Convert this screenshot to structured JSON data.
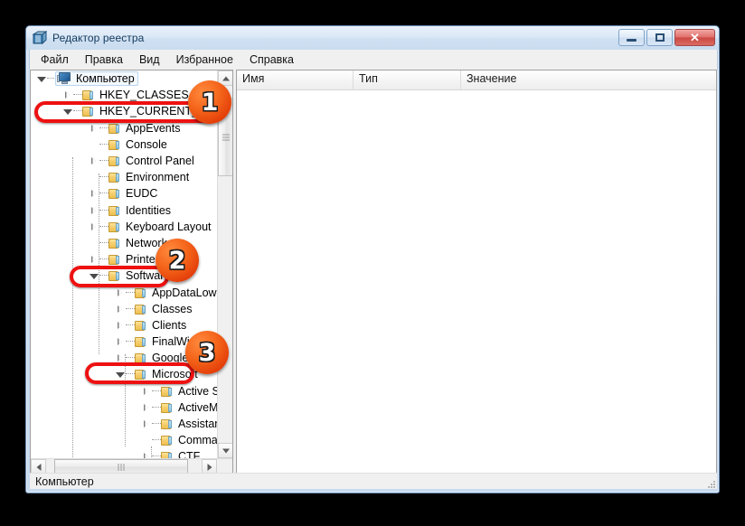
{
  "window": {
    "title": "Редактор реестра",
    "icon": "registry-editor-icon",
    "buttons": {
      "minimize": "minimize-button",
      "maximize": "maximize-button",
      "close": "✕"
    }
  },
  "menu": {
    "items": [
      {
        "label": "Файл"
      },
      {
        "label": "Правка"
      },
      {
        "label": "Вид"
      },
      {
        "label": "Избранное"
      },
      {
        "label": "Справка"
      }
    ]
  },
  "tree": {
    "root": {
      "label": "Компьютер",
      "icon": "computer-icon",
      "expanded": true,
      "selected": true
    },
    "items": [
      {
        "label": "HKEY_CLASSES_ROOT",
        "depth": 1,
        "state": "collapsed"
      },
      {
        "label": "HKEY_CURRENT_USER",
        "depth": 1,
        "state": "expanded"
      },
      {
        "label": "AppEvents",
        "depth": 2,
        "state": "collapsed"
      },
      {
        "label": "Console",
        "depth": 2,
        "state": "leaf"
      },
      {
        "label": "Control Panel",
        "depth": 2,
        "state": "collapsed"
      },
      {
        "label": "Environment",
        "depth": 2,
        "state": "leaf"
      },
      {
        "label": "EUDC",
        "depth": 2,
        "state": "collapsed"
      },
      {
        "label": "Identities",
        "depth": 2,
        "state": "collapsed"
      },
      {
        "label": "Keyboard Layout",
        "depth": 2,
        "state": "collapsed"
      },
      {
        "label": "Network",
        "depth": 2,
        "state": "leaf"
      },
      {
        "label": "Printers",
        "depth": 2,
        "state": "collapsed"
      },
      {
        "label": "Software",
        "depth": 2,
        "state": "expanded"
      },
      {
        "label": "AppDataLow",
        "depth": 3,
        "state": "collapsed"
      },
      {
        "label": "Classes",
        "depth": 3,
        "state": "collapsed"
      },
      {
        "label": "Clients",
        "depth": 3,
        "state": "collapsed"
      },
      {
        "label": "FinalWire",
        "depth": 3,
        "state": "collapsed"
      },
      {
        "label": "Google",
        "depth": 3,
        "state": "collapsed"
      },
      {
        "label": "Microsoft",
        "depth": 3,
        "state": "expanded"
      },
      {
        "label": "Active Setup",
        "depth": 4,
        "state": "collapsed"
      },
      {
        "label": "ActiveMovie",
        "depth": 4,
        "state": "collapsed"
      },
      {
        "label": "Assistance",
        "depth": 4,
        "state": "collapsed"
      },
      {
        "label": "Command Pro",
        "depth": 4,
        "state": "leaf"
      },
      {
        "label": "CTF",
        "depth": 4,
        "state": "collapsed"
      }
    ]
  },
  "list": {
    "columns": [
      {
        "label": "Имя"
      },
      {
        "label": "Тип"
      },
      {
        "label": "Значение"
      }
    ],
    "rows": []
  },
  "statusbar": {
    "path": "Компьютер"
  },
  "annotations": {
    "accent_color": "#ee1111",
    "badge_color": "#f4641a",
    "steps": [
      {
        "number": "1",
        "target": "HKEY_CURRENT_USER"
      },
      {
        "number": "2",
        "target": "Software"
      },
      {
        "number": "3",
        "target": "Microsoft"
      }
    ]
  }
}
